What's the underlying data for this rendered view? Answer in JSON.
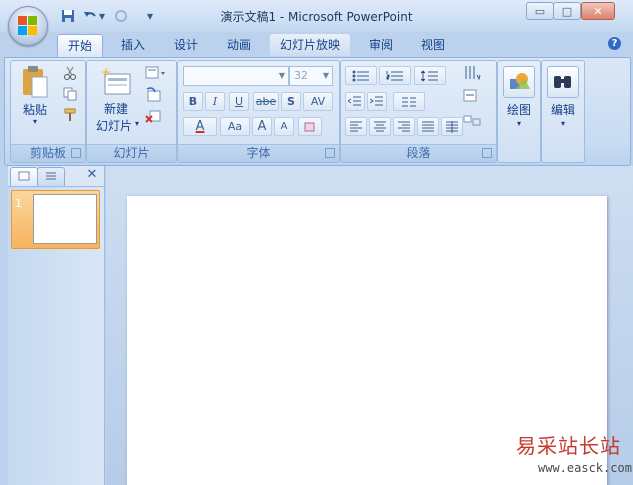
{
  "window": {
    "title": "演示文稿1 - Microsoft PowerPoint",
    "minimize": "▭",
    "maximize": "□",
    "close": "✕"
  },
  "qat": {
    "undo_arrow": "▾",
    "customize": "▾"
  },
  "tabs": [
    {
      "label": "开始"
    },
    {
      "label": "插入"
    },
    {
      "label": "设计"
    },
    {
      "label": "动画"
    },
    {
      "label": "幻灯片放映"
    },
    {
      "label": "审阅"
    },
    {
      "label": "视图"
    }
  ],
  "help": "?",
  "ribbon": {
    "clipboard": {
      "label": "剪贴板",
      "paste": "粘贴",
      "paste_arrow": "▾"
    },
    "slides": {
      "label": "幻灯片",
      "new_slide_line1": "新建",
      "new_slide_line2": "幻灯片",
      "arrow": "▾"
    },
    "font": {
      "label": "字体",
      "font_name": "",
      "font_size": "32",
      "bold": "B",
      "italic": "I",
      "underline": "U",
      "strike": "abe",
      "shadow": "S",
      "spacing": "AV",
      "color": "A",
      "change_case": "Aa",
      "grow": "A",
      "shrink": "A"
    },
    "paragraph": {
      "label": "段落"
    },
    "drawing": {
      "label": "绘图",
      "arrow": "▾"
    },
    "editing": {
      "label": "编辑",
      "arrow": "▾"
    }
  },
  "panel": {
    "close": "✕",
    "slide_number": "1"
  },
  "watermark": {
    "line1": "易采站长站",
    "line2": "www.easck.com"
  },
  "colors": {
    "accent": "#15428b",
    "ribbon": "#c7dbf2",
    "selection": "#f7b25d"
  }
}
